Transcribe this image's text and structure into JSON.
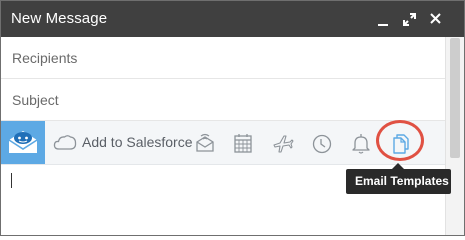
{
  "window": {
    "title": "New Message",
    "controls": [
      "minimize-icon",
      "expand-icon",
      "close-icon"
    ]
  },
  "fields": {
    "recipients_placeholder": "Recipients",
    "subject_placeholder": "Subject"
  },
  "toolbar": {
    "add_to_salesforce": "Add to Salesforce",
    "icons": [
      "salesforce-logo-icon",
      "cloud-icon",
      "tracking-envelope-icon",
      "calendar-icon",
      "airplane-icon",
      "clock-icon",
      "bell-icon",
      "email-templates-icon"
    ]
  },
  "tooltip": {
    "text": "Email Templates"
  },
  "colors": {
    "titlebar": "#404040",
    "accent_blue": "#5da9e4",
    "highlight_ring": "#e05143",
    "tooltip_bg": "#2a2a2a"
  }
}
